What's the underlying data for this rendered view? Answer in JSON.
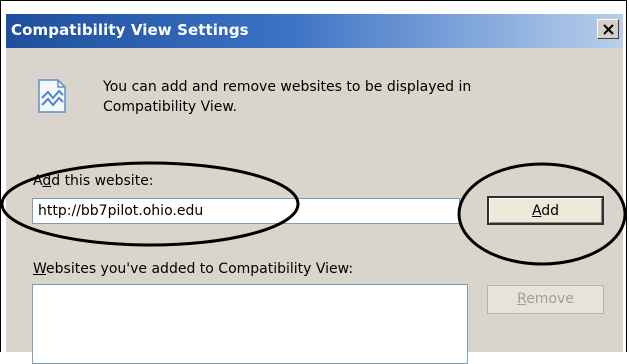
{
  "window": {
    "title": "Compatibility View Settings",
    "close_icon": "close-icon"
  },
  "info": {
    "icon": "compatibility-view-icon",
    "text_line1": "You can add and remove websites to be displayed in",
    "text_line2": "Compatibility View."
  },
  "add_website": {
    "label_prefix": "A",
    "label_access_key": "d",
    "label_rest": "d this website:",
    "value": "http://bb7pilot.ohio.edu",
    "button_access_key": "A",
    "button_rest": "dd"
  },
  "added_list": {
    "label_access_key": "W",
    "label_rest": "ebsites you've added to Compatibility View:",
    "items": []
  },
  "remove_button": {
    "access_key": "R",
    "rest": "emove",
    "enabled": false
  },
  "colors": {
    "titlebar_start": "#1f4f9c",
    "titlebar_end": "#b9cfec",
    "dialog_background": "#d9d5cc",
    "annotation_ink": "#000000"
  }
}
